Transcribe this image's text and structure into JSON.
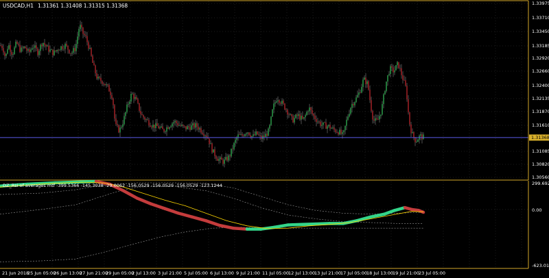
{
  "main_window": {
    "symbol_label": "USDCAD,H1",
    "ohlc_label": "1.31361 1.31408 1.31315 1.31368",
    "current_price": "1.31368",
    "price_ticks": [
      "1.33975",
      "1.33710",
      "1.33450",
      "1.33185",
      "1.32920",
      "1.32660",
      "1.32400",
      "1.32135",
      "1.31870",
      "1.31610",
      "1.31085",
      "1.30820",
      "1.30560"
    ]
  },
  "indicator_window": {
    "label": "DZ_Rsi of averages mtf -399.5366 -145.3038 -29.0062 -156.0529 -156.0529 -156.0529 -123.1244",
    "top_value": "299.6928",
    "zero_label": "0.00",
    "bottom_value": "-623.0198"
  },
  "time_axis": {
    "labels": [
      "21 Jun 2018",
      "25 Jun 05:00",
      "26 Jun 13:00",
      "27 Jun 21:00",
      "29 Jun 05:00",
      "2 Jul 13:00",
      "3 Jul 21:00",
      "5 Jul 05:00",
      "6 Jul 13:00",
      "9 Jul 21:00",
      "11 Jul 05:00",
      "12 Jul 13:00",
      "13 Jul 21:00",
      "17 Jul 05:00",
      "18 Jul 13:00",
      "19 Jul 21:00",
      "23 Jul 05:00"
    ]
  },
  "colors": {
    "background": "#000000",
    "axis": "#d4a82a",
    "grid": "#3a3a3a",
    "bull_candle": "#2fa84f",
    "bear_candle": "#b0242a",
    "wick": "#888888",
    "price_line": "#5a5ae8",
    "current_price_tag": "#d8b02c",
    "rsi_up": "#33d68a",
    "rsi_down": "#c43c3c",
    "signal_line": "#ffd700",
    "levels": "#9a9a9a"
  },
  "chart_data": {
    "type": "candlestick",
    "symbol": "USDCAD",
    "timeframe": "H1",
    "ylim": [
      1.3056,
      1.34
    ],
    "close_anchors": [
      [
        0,
        1.3315
      ],
      [
        4,
        1.3312
      ],
      [
        8,
        1.329
      ],
      [
        12,
        1.3318
      ],
      [
        18,
        1.3298
      ],
      [
        24,
        1.332
      ],
      [
        30,
        1.3305
      ],
      [
        36,
        1.3312
      ],
      [
        42,
        1.33
      ],
      [
        48,
        1.3315
      ],
      [
        55,
        1.3302
      ],
      [
        62,
        1.3322
      ],
      [
        70,
        1.3308
      ],
      [
        78,
        1.33
      ],
      [
        86,
        1.331
      ],
      [
        95,
        1.3315
      ],
      [
        104,
        1.33
      ],
      [
        110,
        1.331
      ],
      [
        116,
        1.3355
      ],
      [
        120,
        1.334
      ],
      [
        125,
        1.333
      ],
      [
        130,
        1.331
      ],
      [
        136,
        1.3275
      ],
      [
        142,
        1.325
      ],
      [
        150,
        1.3245
      ],
      [
        158,
        1.3232
      ],
      [
        164,
        1.3215
      ],
      [
        168,
        1.316
      ],
      [
        174,
        1.315
      ],
      [
        180,
        1.317
      ],
      [
        186,
        1.32
      ],
      [
        192,
        1.3222
      ],
      [
        198,
        1.321
      ],
      [
        206,
        1.318
      ],
      [
        214,
        1.317
      ],
      [
        222,
        1.316
      ],
      [
        230,
        1.3158
      ],
      [
        238,
        1.315
      ],
      [
        246,
        1.316
      ],
      [
        254,
        1.3168
      ],
      [
        262,
        1.316
      ],
      [
        270,
        1.3155
      ],
      [
        278,
        1.3158
      ],
      [
        286,
        1.316
      ],
      [
        294,
        1.315
      ],
      [
        302,
        1.314
      ],
      [
        310,
        1.311
      ],
      [
        318,
        1.3095
      ],
      [
        326,
        1.309
      ],
      [
        334,
        1.31
      ],
      [
        340,
        1.312
      ],
      [
        346,
        1.314
      ],
      [
        352,
        1.314
      ],
      [
        360,
        1.315
      ],
      [
        368,
        1.3138
      ],
      [
        374,
        1.3145
      ],
      [
        380,
        1.3135
      ],
      [
        386,
        1.314
      ],
      [
        392,
        1.315
      ],
      [
        398,
        1.3195
      ],
      [
        404,
        1.3215
      ],
      [
        410,
        1.3205
      ],
      [
        418,
        1.319
      ],
      [
        426,
        1.317
      ],
      [
        434,
        1.318
      ],
      [
        442,
        1.317
      ],
      [
        450,
        1.3195
      ],
      [
        456,
        1.318
      ],
      [
        462,
        1.317
      ],
      [
        468,
        1.3162
      ],
      [
        474,
        1.316
      ],
      [
        480,
        1.3158
      ],
      [
        486,
        1.3152
      ],
      [
        494,
        1.3148
      ],
      [
        500,
        1.314
      ],
      [
        506,
        1.3175
      ],
      [
        512,
        1.32
      ],
      [
        518,
        1.321
      ],
      [
        524,
        1.3225
      ],
      [
        530,
        1.325
      ],
      [
        536,
        1.324
      ],
      [
        540,
        1.32
      ],
      [
        544,
        1.317
      ],
      [
        550,
        1.3168
      ],
      [
        556,
        1.319
      ],
      [
        562,
        1.324
      ],
      [
        568,
        1.327
      ],
      [
        574,
        1.3265
      ],
      [
        580,
        1.328
      ],
      [
        586,
        1.3255
      ],
      [
        592,
        1.323
      ],
      [
        596,
        1.317
      ],
      [
        600,
        1.3145
      ],
      [
        606,
        1.313
      ],
      [
        612,
        1.314
      ],
      [
        617,
        1.3137
      ]
    ],
    "rsi": {
      "ylim": [
        -623.0198,
        299.6928
      ],
      "main_line": [
        [
          0,
          250
        ],
        [
          40,
          270
        ],
        [
          80,
          285
        ],
        [
          120,
          295
        ],
        [
          140,
          300
        ],
        [
          160,
          270
        ],
        [
          180,
          200
        ],
        [
          200,
          120
        ],
        [
          220,
          60
        ],
        [
          240,
          10
        ],
        [
          260,
          -40
        ],
        [
          280,
          -80
        ],
        [
          300,
          -120
        ],
        [
          320,
          -170
        ],
        [
          340,
          -200
        ],
        [
          360,
          -210
        ],
        [
          380,
          -210
        ],
        [
          400,
          -190
        ],
        [
          420,
          -165
        ],
        [
          440,
          -160
        ],
        [
          460,
          -155
        ],
        [
          480,
          -150
        ],
        [
          500,
          -150
        ],
        [
          520,
          -120
        ],
        [
          540,
          -80
        ],
        [
          560,
          -50
        ],
        [
          575,
          -10
        ],
        [
          590,
          20
        ],
        [
          600,
          0
        ],
        [
          610,
          -10
        ],
        [
          617,
          -30
        ]
      ],
      "signal_line": [
        [
          0,
          240
        ],
        [
          40,
          262
        ],
        [
          80,
          280
        ],
        [
          120,
          292
        ],
        [
          150,
          285
        ],
        [
          180,
          240
        ],
        [
          210,
          170
        ],
        [
          240,
          100
        ],
        [
          270,
          40
        ],
        [
          300,
          -40
        ],
        [
          330,
          -120
        ],
        [
          360,
          -175
        ],
        [
          390,
          -205
        ],
        [
          420,
          -200
        ],
        [
          450,
          -175
        ],
        [
          480,
          -160
        ],
        [
          510,
          -140
        ],
        [
          540,
          -100
        ],
        [
          570,
          -60
        ],
        [
          600,
          -20
        ],
        [
          617,
          -25
        ]
      ],
      "upper_level": [
        [
          0,
          160
        ],
        [
          60,
          175
        ],
        [
          110,
          210
        ],
        [
          140,
          250
        ],
        [
          170,
          270
        ],
        [
          200,
          285
        ],
        [
          250,
          285
        ],
        [
          300,
          280
        ],
        [
          340,
          230
        ],
        [
          380,
          140
        ],
        [
          420,
          50
        ],
        [
          460,
          -10
        ],
        [
          500,
          -40
        ],
        [
          540,
          -50
        ],
        [
          580,
          -40
        ],
        [
          617,
          -30
        ]
      ],
      "mid_level": [
        [
          0,
          -50
        ],
        [
          60,
          0
        ],
        [
          110,
          50
        ],
        [
          140,
          120
        ],
        [
          170,
          190
        ],
        [
          200,
          240
        ],
        [
          250,
          250
        ],
        [
          300,
          200
        ],
        [
          340,
          120
        ],
        [
          380,
          20
        ],
        [
          420,
          -60
        ],
        [
          460,
          -100
        ],
        [
          500,
          -130
        ],
        [
          540,
          -140
        ],
        [
          580,
          -150
        ],
        [
          617,
          -150
        ]
      ],
      "lower_level": [
        [
          0,
          -560
        ],
        [
          60,
          -550
        ],
        [
          110,
          -530
        ],
        [
          150,
          -460
        ],
        [
          190,
          -380
        ],
        [
          230,
          -300
        ],
        [
          270,
          -240
        ],
        [
          310,
          -200
        ],
        [
          350,
          -190
        ],
        [
          390,
          -200
        ],
        [
          430,
          -200
        ],
        [
          470,
          -200
        ],
        [
          510,
          -200
        ],
        [
          550,
          -200
        ],
        [
          590,
          -200
        ],
        [
          617,
          -200
        ]
      ]
    }
  }
}
